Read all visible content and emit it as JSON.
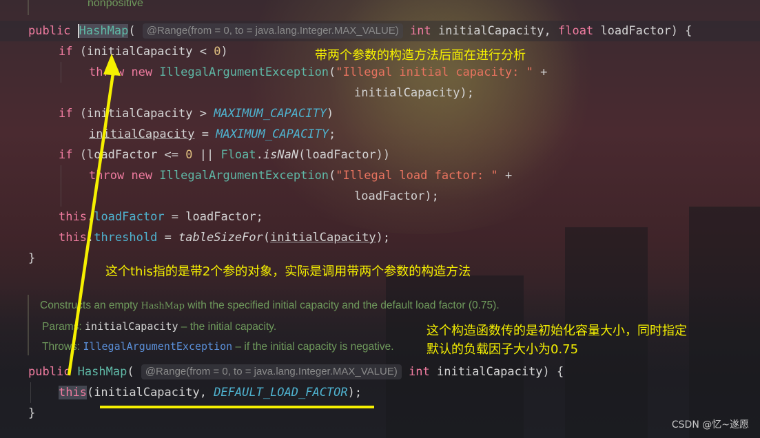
{
  "doc_top": {
    "text": "nonpositive"
  },
  "ctor2": {
    "modifier": "public",
    "name": "HashMap",
    "open": "(",
    "inlay": "@Range(from = 0, to = java.lang.Integer.MAX_VALUE)",
    "type1": "int",
    "param1": " initialCapacity, ",
    "type2": "float",
    "param2": " loadFactor) {",
    "lines": {
      "if1_kw": "if",
      "if1_a": " (initialCapacity < ",
      "if1_num": "0",
      "if1_b": ")",
      "throw1_kw": "throw",
      "throw1_new": "new",
      "throw1_cls": "IllegalArgumentException",
      "throw1_open": "(",
      "throw1_str": "\"Illegal initial capacity: \"",
      "throw1_plus": " +",
      "throw1_cont": "initialCapacity);",
      "if2_kw": "if",
      "if2_a": " (initialCapacity > ",
      "if2_const": "MAXIMUM_CAPACITY",
      "if2_b": ")",
      "assign_var": "initialCapacity",
      "assign_eq": " = ",
      "assign_const": "MAXIMUM_CAPACITY",
      "assign_end": ";",
      "if3_kw": "if",
      "if3_a": " (loadFactor <= ",
      "if3_num": "0",
      "if3_b": " || ",
      "if3_cls": "Float",
      "if3_dot": ".",
      "if3_fn": "isNaN",
      "if3_c": "(loadFactor))",
      "throw2_kw": "throw",
      "throw2_new": "new",
      "throw2_cls": "IllegalArgumentException",
      "throw2_open": "(",
      "throw2_str": "\"Illegal load factor: \"",
      "throw2_plus": " +",
      "throw2_cont": "loadFactor);",
      "this1_kw": "this",
      "this1_dot": ".",
      "this1_fld": "loadFactor",
      "this1_rest": " = loadFactor;",
      "this2_kw": "this",
      "this2_dot": ".",
      "this2_fld": "threshold",
      "this2_eq": " = ",
      "this2_fn": "tableSizeFor",
      "this2_open": "(",
      "this2_arg": "initialCapacity",
      "this2_end": ");",
      "close": "}"
    }
  },
  "javadoc": {
    "summary_a": "Constructs an empty ",
    "summary_code": "HashMap",
    "summary_b": " with the specified initial capacity and the default load factor (0.75).",
    "params_label": "Params: ",
    "params_name": "initialCapacity",
    "params_desc": " – the initial capacity.",
    "throws_label": "Throws: ",
    "throws_name": "IllegalArgumentException",
    "throws_desc": " – if the initial capacity is negative."
  },
  "ctor1": {
    "modifier": "public",
    "name": "HashMap",
    "open": "(",
    "inlay": "@Range(from = 0, to = java.lang.Integer.MAX_VALUE)",
    "type1": "int",
    "param1": " initialCapacity) {",
    "this_kw": "this",
    "this_args_a": "(initialCapacity, ",
    "this_const": "DEFAULT_LOAD_FACTOR",
    "this_end": ");",
    "close": "}"
  },
  "annotations": {
    "note1": "带两个参数的构造方法后面在进行分析",
    "note2": "这个this指的是带2个参的对象，实际是调用带两个参数的构造方法",
    "note3_line1": "这个构造函数传的是初始化容量大小，同时指定",
    "note3_line2": "默认的负载因子大小为0.75",
    "color": "#f5f000"
  },
  "watermark": "CSDN @忆~遂愿"
}
